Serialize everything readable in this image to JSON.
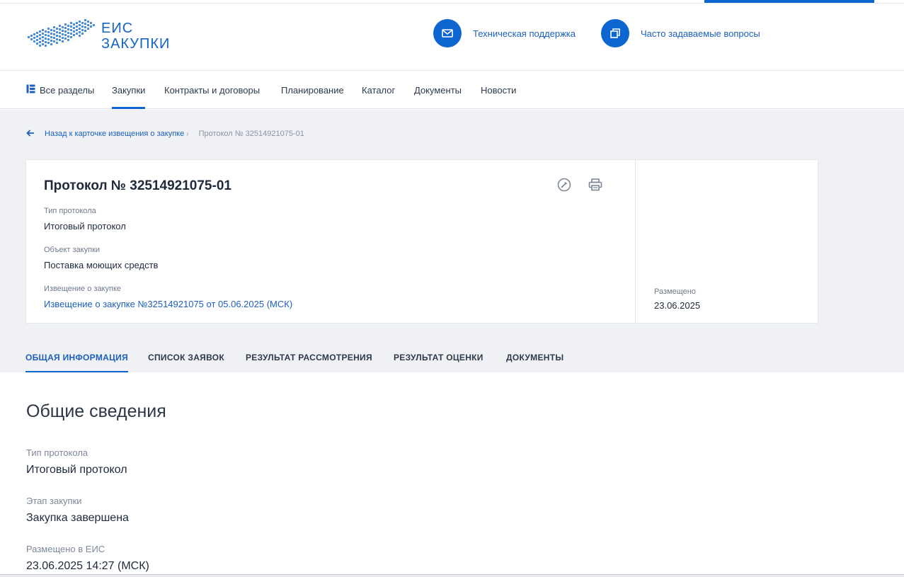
{
  "header": {
    "logo_line1": "ЕИС",
    "logo_line2": "ЗАКУПКИ",
    "support_label": "Техническая поддержка",
    "faq_label": "Часто задаваемые вопросы",
    "support_icon": "mail-icon",
    "faq_icon": "copy-icon"
  },
  "nav": {
    "items": [
      {
        "label": "Все разделы",
        "icon": "sections-icon",
        "active": false
      },
      {
        "label": "Закупки",
        "active": true
      },
      {
        "label": "Контракты и договоры",
        "active": false
      },
      {
        "label": "Планирование",
        "active": false
      },
      {
        "label": "Каталог",
        "active": false
      },
      {
        "label": "Документы",
        "active": false
      },
      {
        "label": "Новости",
        "active": false
      }
    ]
  },
  "breadcrumb": {
    "back_label": "Назад к карточке извещения о закупке",
    "current": "Протокол № 32514921075-01"
  },
  "card": {
    "title": "Протокол № 32514921075-01",
    "fields": [
      {
        "label": "Тип протокола",
        "value": "Итоговый протокол"
      },
      {
        "label": "Объект закупки",
        "value": "Поставка моющих средств"
      },
      {
        "label": "Извещение о закупке",
        "value": "Извещение о закупке №32514921075 от 05.06.2025 (МСК)"
      }
    ],
    "placed_label": "Размещено",
    "placed_value": "23.06.2025"
  },
  "tabs": [
    {
      "label": "ОБЩАЯ ИНФОРМАЦИЯ",
      "active": true
    },
    {
      "label": "СПИСОК ЗАЯВОК",
      "active": false
    },
    {
      "label": "РЕЗУЛЬТАТ РАССМОТРЕНИЯ",
      "active": false
    },
    {
      "label": "РЕЗУЛЬТАТ ОЦЕНКИ",
      "active": false
    },
    {
      "label": "ДОКУМЕНТЫ",
      "active": false
    }
  ],
  "general": {
    "title": "Общие сведения",
    "fields": [
      {
        "label": "Тип протокола",
        "value": "Итоговый протокол"
      },
      {
        "label": "Этап закупки",
        "value": "Закупка завершена"
      },
      {
        "label": "Размещено в ЕИС",
        "value": "23.06.2025 14:27 (МСК)"
      }
    ]
  },
  "colors": {
    "accent": "#0d66d0",
    "link": "#1c5fbf",
    "background_grey": "#eff1f4"
  }
}
